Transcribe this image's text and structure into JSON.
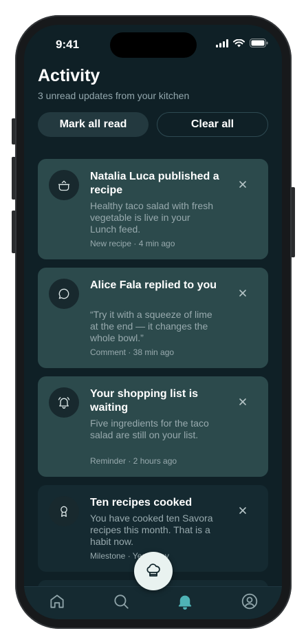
{
  "status_bar": {
    "time": "9:41"
  },
  "header": {
    "title": "Activity",
    "subtitle": "3 unread updates from your kitchen"
  },
  "actions": {
    "mark_all_read": "Mark all read",
    "clear_all": "Clear all"
  },
  "notifications": [
    {
      "title": "Natalia Luca published a recipe",
      "body": "Healthy taco salad with fresh vegetable is live in your Lunch feed.",
      "meta": "New recipe · 4 min ago",
      "icon": "cooking-pot-icon",
      "unread": true
    },
    {
      "title": "Alice Fala replied to you",
      "body": "“Try it with a squeeze of lime at the end — it changes the whole bowl.”",
      "meta": "Comment · 38 min ago",
      "icon": "chat-bubble-icon",
      "unread": true
    },
    {
      "title": "Your shopping list is waiting",
      "body": "Five ingredients for the taco salad are still on your list.",
      "meta": "Reminder · 2 hours ago",
      "icon": "bell-ringing-icon",
      "unread": true
    },
    {
      "title": "Ten recipes cooked",
      "body": "You have cooked ten Savora recipes this month. That is a habit now.",
      "meta": "Milestone · Yesterday",
      "icon": "award-ribbon-icon",
      "unread": false
    }
  ],
  "tab_bar": {
    "tabs": [
      "home-icon",
      "search-icon",
      "bell-icon",
      "profile-icon"
    ],
    "active": "bell-icon",
    "fab_icon": "chef-hat-icon"
  },
  "colors": {
    "background": "#0f2026",
    "unread_card": "#2c4a4c",
    "read_card": "#152a31",
    "accent": "#4fb3b6",
    "muted_text": "#98aaae"
  }
}
